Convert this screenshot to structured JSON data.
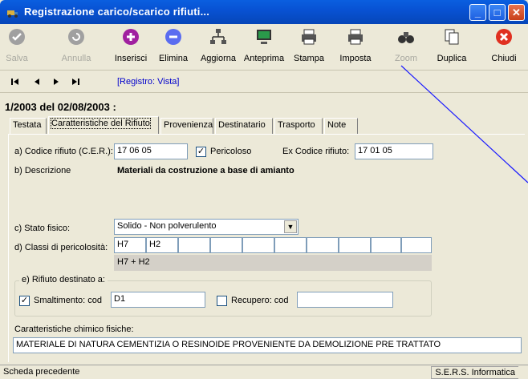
{
  "window": {
    "title": "Registrazione carico/scarico rifiuti...",
    "buttons": {
      "minimize": "_",
      "maximize": "□",
      "close": "✕"
    }
  },
  "toolbar": {
    "save": "Salva",
    "cancel": "Annulla",
    "insert": "Inserisci",
    "delete": "Elimina",
    "update": "Aggiorna",
    "preview": "Anteprima",
    "print": "Stampa",
    "setup": "Imposta",
    "zoom": "Zoom",
    "duplicate": "Duplica",
    "close": "Chiudi"
  },
  "nav": {
    "first": "|◄",
    "prev": "◄",
    "next": "►",
    "last": "►|",
    "register_mode": "[Registro: Vista]"
  },
  "record_title": "1/2003 del 02/08/2003 :",
  "tabs": [
    "Testata",
    "Caratteristiche del Rifiuto",
    "Provenienza",
    "Destinatario",
    "Trasporto",
    "Note"
  ],
  "active_tab": 1,
  "form": {
    "codice_label": "a) Codice rifiuto (C.E.R.):",
    "codice_value": "17 06 05",
    "pericoloso_label": "Pericoloso",
    "pericoloso_checked": "✓",
    "ex_codice_label": "Ex Codice rifiuto:",
    "ex_codice_value": "17 01 05",
    "descrizione_label": "b) Descrizione",
    "descrizione_value": "Materiali da costruzione a base di amianto",
    "stato_label": "c) Stato fisico:",
    "stato_value": "Solido - Non polverulento",
    "classi_label": "d) Classi di pericolosità:",
    "classi": [
      "H7",
      "H2",
      "",
      "",
      "",
      "",
      "",
      "",
      "",
      ""
    ],
    "classi_summary": "H7 + H2",
    "destinato_label": "e) Rifiuto destinato a:",
    "smaltimento_label": "Smaltimento: cod",
    "smaltimento_checked": "✓",
    "smaltimento_value": "D1",
    "recupero_label": "Recupero: cod",
    "recupero_value": "",
    "chimiche_label": "Caratteristiche chimico fisiche:",
    "chimiche_value": "MATERIALE DI NATURA CEMENTIZIA O RESINOIDE PROVENIENTE DA DEMOLIZIONE PRE TRATTATO"
  },
  "status": {
    "left": "Scheda precedente",
    "right": "S.E.R.S. Informatica"
  },
  "colors": {
    "titlebar": "#0852d4",
    "link_blue": "#0000cc",
    "insert_icon": "#a020a0",
    "delete_icon": "#5a6cf0",
    "close_icon": "#e03020"
  }
}
